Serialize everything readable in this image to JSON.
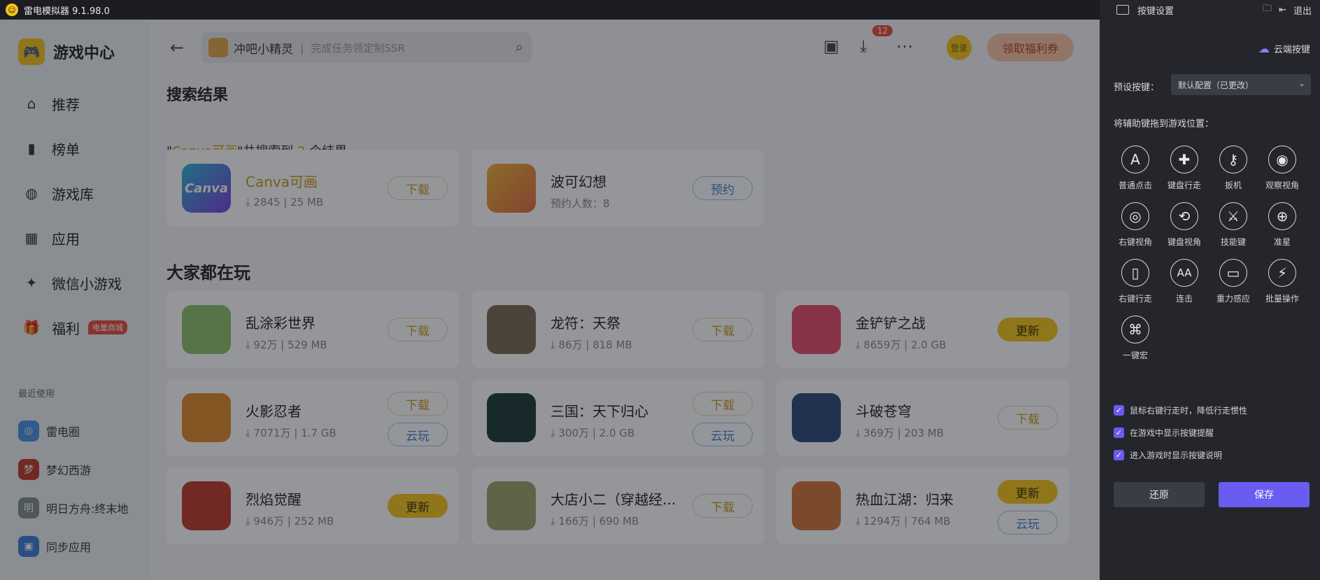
{
  "window": {
    "title": "雷电模拟器 9.1.98.0"
  },
  "sidebar": {
    "brand": "游戏中心",
    "items": [
      {
        "label": "推荐",
        "icon": "home-icon"
      },
      {
        "label": "榜单",
        "icon": "ranking-icon"
      },
      {
        "label": "游戏库",
        "icon": "gamepad-icon"
      },
      {
        "label": "应用",
        "icon": "apps-icon"
      },
      {
        "label": "微信小游戏",
        "icon": "wechat-game-icon"
      },
      {
        "label": "福利",
        "icon": "gift-icon",
        "badge": "电量商城"
      }
    ],
    "recent_title": "最近使用",
    "recent": [
      {
        "label": "雷电圈",
        "color": "#4a90e2"
      },
      {
        "label": "梦幻西游",
        "color": "#c0392b"
      },
      {
        "label": "明日方舟:终末地",
        "color": "#7f8c8d"
      },
      {
        "label": "同步应用",
        "color": "#3b7fd6"
      }
    ]
  },
  "topbar": {
    "search_keyword": "冲吧小精灵",
    "search_placeholder": "完成任务领定制SSR",
    "download_badge": "12",
    "login": "登录",
    "coupon": "领取福利券"
  },
  "results": {
    "title": "搜索结果",
    "summary_prefix": "\"",
    "summary_query": "Canva可画",
    "summary_mid": "\"共搜索到 ",
    "summary_count": "2",
    "summary_suffix": " 个结果",
    "items": [
      {
        "name": "Canva可画",
        "downloads": "2845",
        "size": "25 MB",
        "button": "下载",
        "icon_text": "Canva",
        "icon_color": "#4d7de0"
      },
      {
        "name": "波可幻想",
        "meta": "预约人数：8",
        "button": "预约",
        "icon_color": "#e06a3c"
      }
    ]
  },
  "popular": {
    "title": "大家都在玩",
    "items": [
      {
        "name": "乱涂彩世界",
        "downloads": "92万",
        "size": "529 MB",
        "buttons": [
          "下载"
        ],
        "icon_color": "#8cc26a"
      },
      {
        "name": "龙符：天祭",
        "downloads": "86万",
        "size": "818 MB",
        "buttons": [
          "下载"
        ],
        "icon_color": "#7a6a55"
      },
      {
        "name": "金铲铲之战",
        "downloads": "8659万",
        "size": "2.0 GB",
        "buttons": [
          "更新"
        ],
        "icon_color": "#e84a6a"
      },
      {
        "name": "火影忍者",
        "downloads": "7071万",
        "size": "1.7 GB",
        "buttons": [
          "下载",
          "云玩"
        ],
        "icon_color": "#e08a2a"
      },
      {
        "name": "三国：天下归心",
        "downloads": "300万",
        "size": "2.0 GB",
        "buttons": [
          "下载",
          "云玩"
        ],
        "icon_color": "#1c3a3a"
      },
      {
        "name": "斗破苍穹",
        "downloads": "369万",
        "size": "203 MB",
        "buttons": [
          "下载"
        ],
        "icon_color": "#2a4a7a"
      },
      {
        "name": "烈焰觉醒",
        "downloads": "946万",
        "size": "252 MB",
        "buttons": [
          "更新"
        ],
        "icon_color": "#c0392b"
      },
      {
        "name": "大店小二（穿越经...",
        "downloads": "166万",
        "size": "690 MB",
        "buttons": [
          "下载"
        ],
        "icon_color": "#9aa56a"
      },
      {
        "name": "热血江湖：归来",
        "downloads": "1294万",
        "size": "764 MB",
        "buttons": [
          "更新",
          "云玩"
        ],
        "icon_color": "#d0763a"
      }
    ]
  },
  "panel": {
    "title": "按键设置",
    "exit": "退出",
    "cloud_keys": "云端按键",
    "preset_label": "预设按键：",
    "preset_value": "默认配置（已更改）",
    "drag_label": "将辅助键拖到游戏位置：",
    "keys": [
      {
        "label": "普通点击",
        "glyph": "A"
      },
      {
        "label": "键盘行走",
        "glyph": "✚"
      },
      {
        "label": "扳机",
        "glyph": "⚷"
      },
      {
        "label": "观察视角",
        "glyph": "◉"
      },
      {
        "label": "右键视角",
        "glyph": "◎"
      },
      {
        "label": "键盘视角",
        "glyph": "⟲"
      },
      {
        "label": "技能键",
        "glyph": "⚔"
      },
      {
        "label": "准星",
        "glyph": "⊕"
      },
      {
        "label": "右键行走",
        "glyph": "▯"
      },
      {
        "label": "连击",
        "glyph": "AA"
      },
      {
        "label": "重力感应",
        "glyph": "▭"
      },
      {
        "label": "批量操作",
        "glyph": "⚡"
      },
      {
        "label": "一键宏",
        "glyph": "⌘"
      }
    ],
    "options": [
      "鼠标右键行走时，降低行走惯性",
      "在游戏中显示按键提醒",
      "进入游戏时显示按键说明"
    ],
    "reset": "还原",
    "save": "保存"
  }
}
